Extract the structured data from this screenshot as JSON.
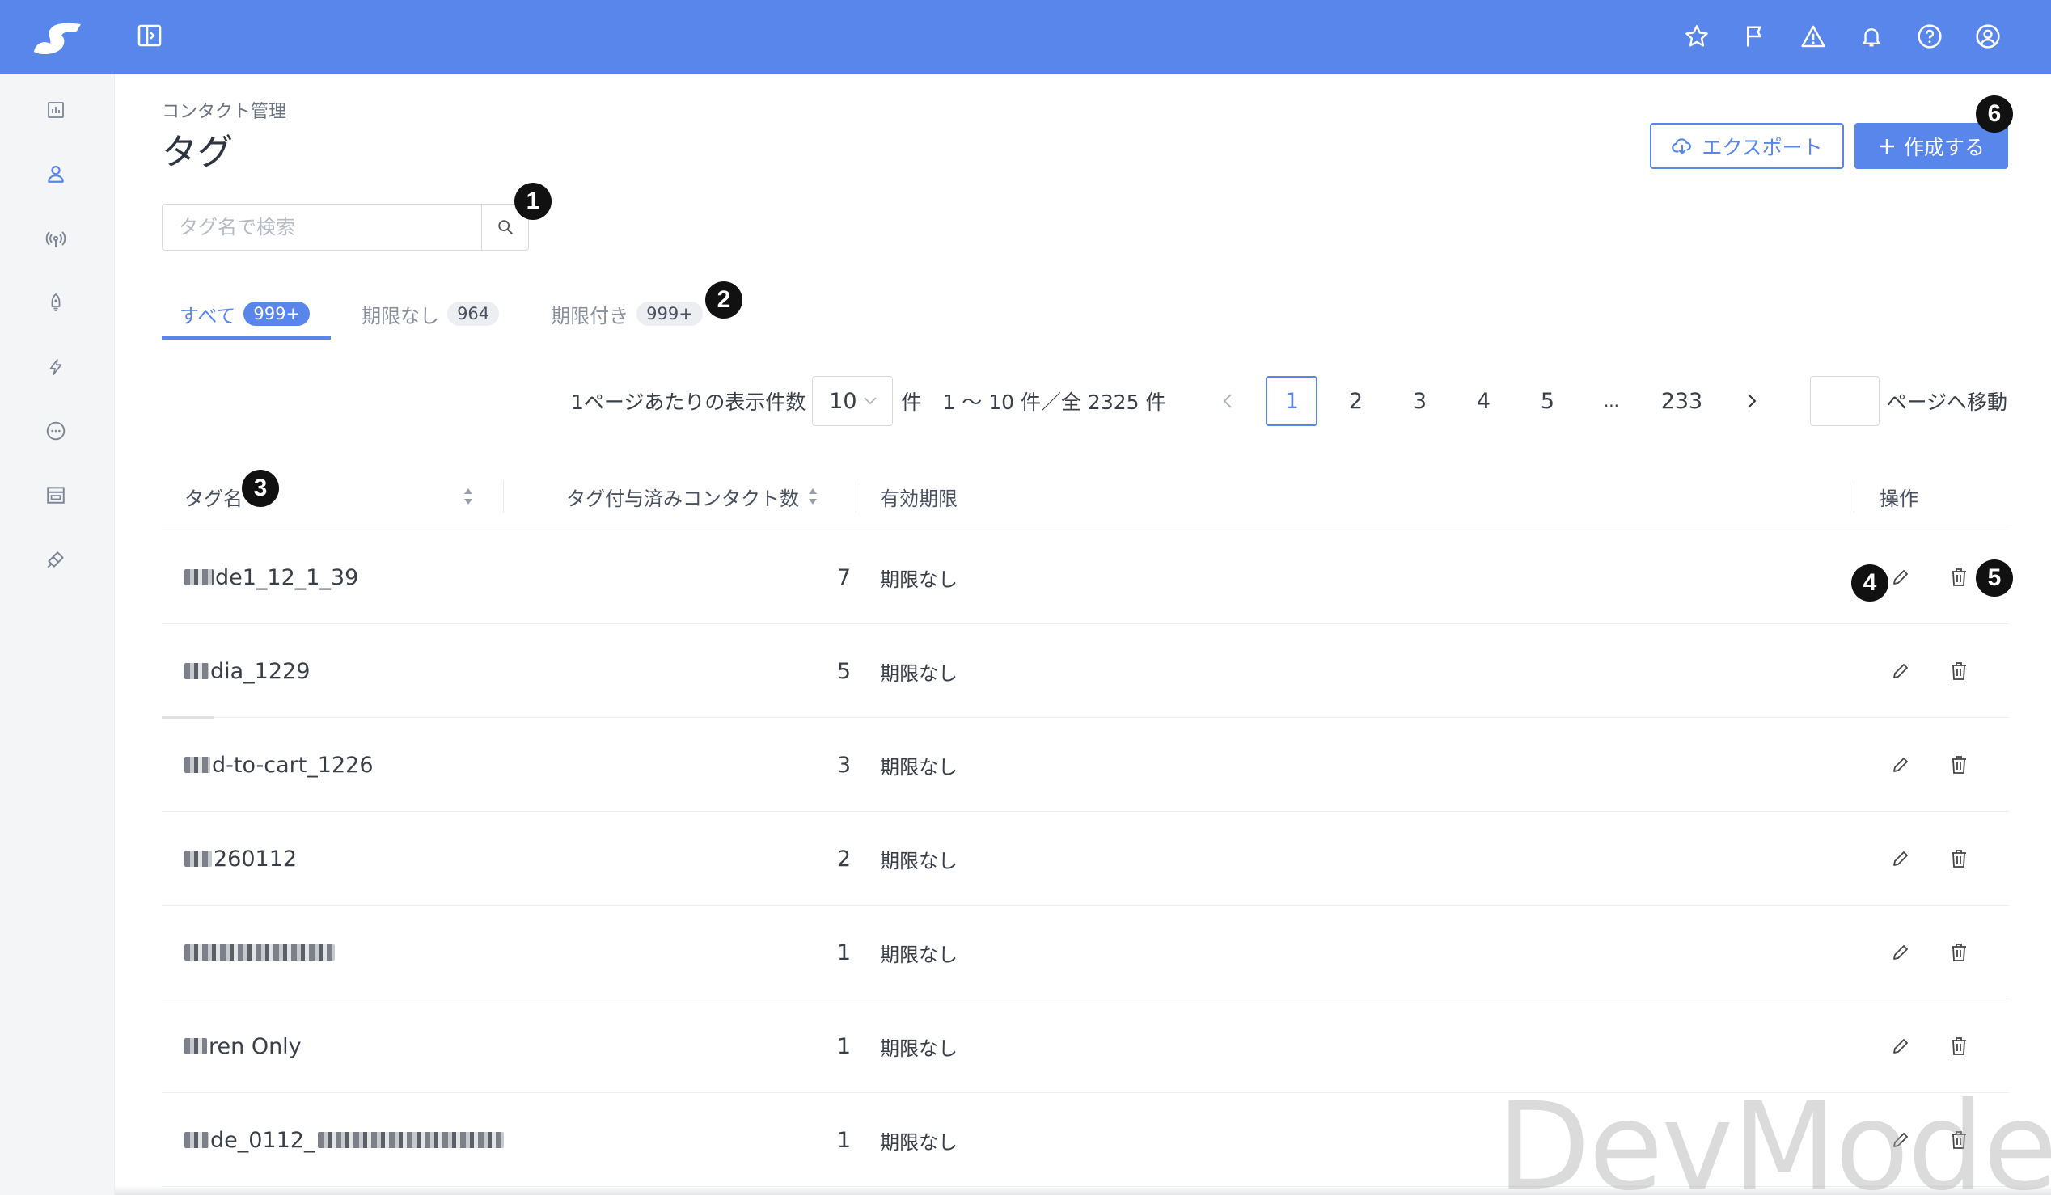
{
  "header": {
    "icons": [
      "star-icon",
      "flag-icon",
      "warning-icon",
      "bell-icon",
      "help-icon",
      "user-icon"
    ]
  },
  "sidebar": {
    "icons": [
      "chart-icon",
      "contact-icon",
      "broadcast-icon",
      "rocket-icon",
      "lightning-icon",
      "chat-icon",
      "store-icon",
      "plugin-icon"
    ]
  },
  "breadcrumb": "コンタクト管理",
  "title": "タグ",
  "actions": {
    "export_label": "エクスポート",
    "create_label": "作成する"
  },
  "search": {
    "placeholder": "タグ名で検索",
    "value": ""
  },
  "tabs": [
    {
      "label": "すべて",
      "count": "999+"
    },
    {
      "label": "期限なし",
      "count": "964"
    },
    {
      "label": "期限付き",
      "count": "999+"
    }
  ],
  "pagination": {
    "per_page_label": "1ページあたりの表示件数",
    "per_page_value": "10",
    "unit": "件",
    "range": "1 〜 10 件／全 2325 件",
    "pages": [
      "1",
      "2",
      "3",
      "4",
      "5",
      "...",
      "233"
    ],
    "current": "1",
    "jump_label": "ページへ移動"
  },
  "table": {
    "columns": {
      "name": "タグ名",
      "count": "タグ付与済みコンタクト数",
      "expiry": "有効期限",
      "actions": "操作"
    },
    "rows": [
      {
        "name": "de1_12_1_39",
        "count": "7",
        "expiry": "期限なし"
      },
      {
        "name": "dia_1229",
        "count": "5",
        "expiry": "期限なし"
      },
      {
        "name": "d-to-cart_1226",
        "count": "3",
        "expiry": "期限なし"
      },
      {
        "name": "260112",
        "count": "2",
        "expiry": "期限なし"
      },
      {
        "name": "",
        "count": "1",
        "expiry": "期限なし"
      },
      {
        "name": "ren Only",
        "count": "1",
        "expiry": "期限なし"
      },
      {
        "name": "de_0112_",
        "count": "1",
        "expiry": "期限なし"
      }
    ]
  },
  "callouts": [
    "1",
    "2",
    "3",
    "4",
    "5",
    "6"
  ],
  "watermark": "DevMode",
  "colors": {
    "brand": "#5886ea",
    "sidebar": "#f4f5f7",
    "callout": "#111111"
  }
}
